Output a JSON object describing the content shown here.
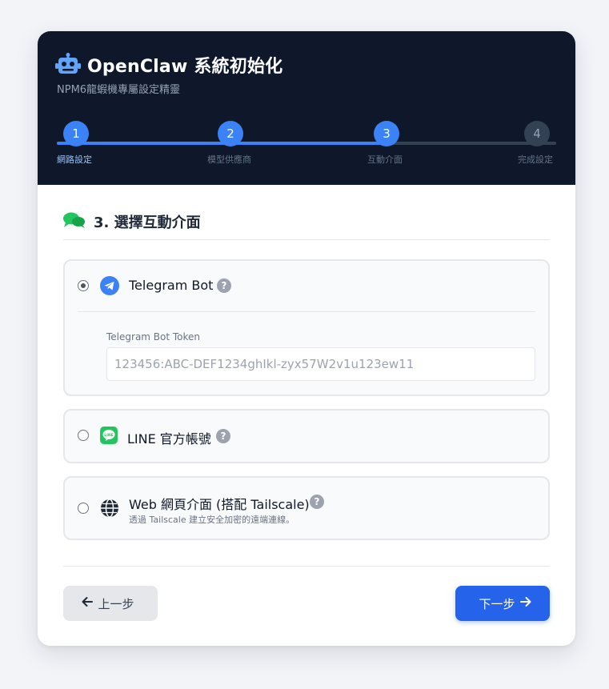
{
  "header": {
    "title": "OpenClaw 系統初始化",
    "subtitle": "NPM6龍蝦機專屬設定精靈",
    "icon": "robot-icon"
  },
  "stepper": {
    "current_step": 3,
    "steps": [
      {
        "number": "1",
        "label": "網路設定",
        "state": "completed"
      },
      {
        "number": "2",
        "label": "模型供應商",
        "state": "completed"
      },
      {
        "number": "3",
        "label": "互動介面",
        "state": "active"
      },
      {
        "number": "4",
        "label": "完成設定",
        "state": "pending"
      }
    ]
  },
  "section": {
    "title": "3. 選擇互動介面",
    "icon": "chat-bubbles-icon"
  },
  "options": [
    {
      "label": "Telegram Bot",
      "icon": "telegram-icon",
      "selected": true,
      "help": "?",
      "field": {
        "label": "Telegram Bot Token",
        "placeholder": "123456:ABC-DEF1234ghIkl-zyx57W2v1u123ew11",
        "value": ""
      }
    },
    {
      "label": "LINE 官方帳號",
      "icon": "line-icon",
      "selected": false,
      "help": "?"
    },
    {
      "label": "Web 網頁介面 (搭配 Tailscale)",
      "icon": "globe-icon",
      "selected": false,
      "help": "?",
      "description": "透過 Tailscale 建立安全加密的遠端連線。"
    }
  ],
  "buttons": {
    "prev_label": "上一步",
    "next_label": "下一步"
  },
  "colors": {
    "header_bg": "#0f172a",
    "accent": "#3b82f6",
    "primary_button": "#2563eb",
    "line_green": "#22c55e",
    "section_icon_green": "#22c55e"
  }
}
